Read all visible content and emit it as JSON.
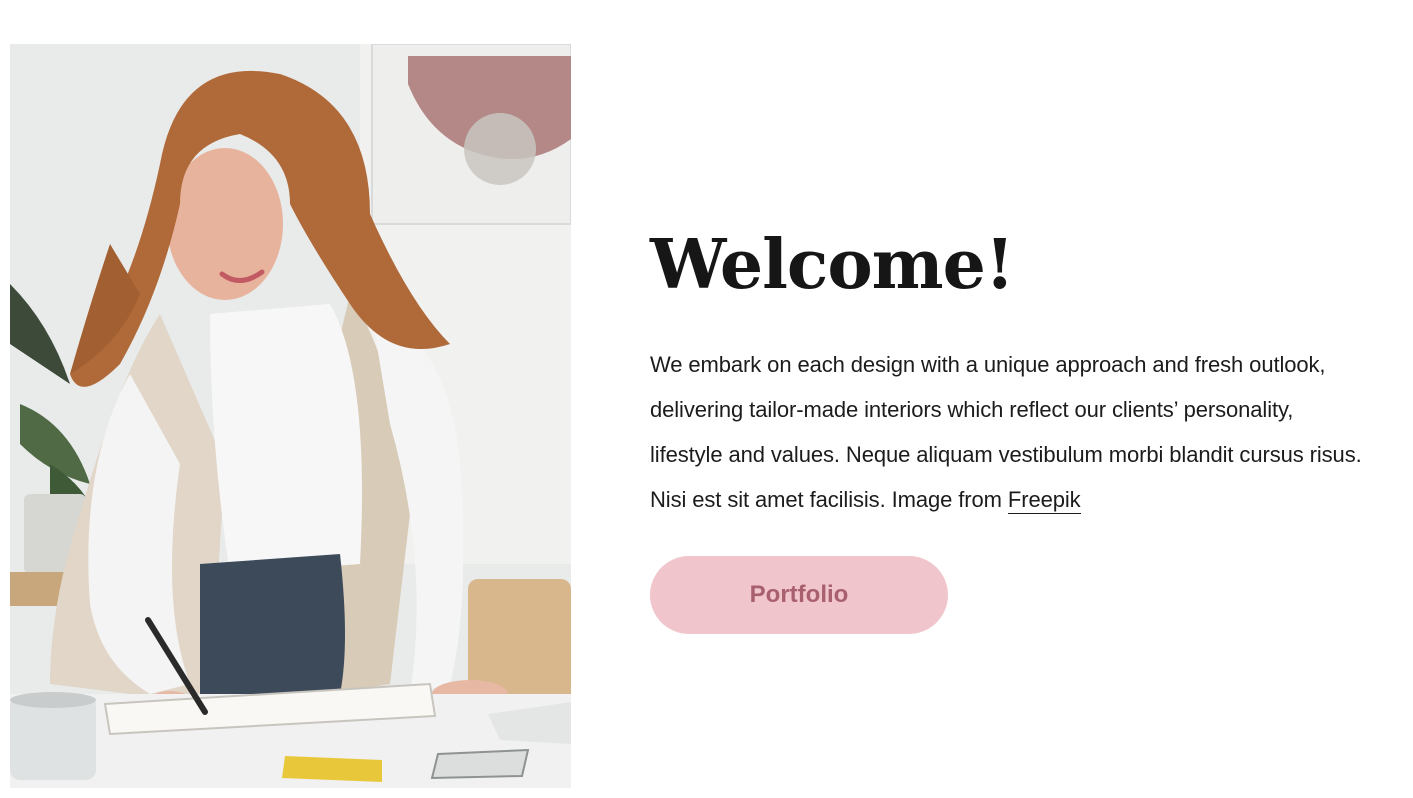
{
  "hero": {
    "image_description": "woman-at-desk-photo"
  },
  "content": {
    "title": "Welcome!",
    "intro_text": "We embark on each design with a unique approach and fresh outlook, delivering tailor-made interiors which reflect our clients’ personality, lifestyle and values. Neque aliquam vestibulum morbi blandit cursus risus. Nisi est sit amet facilisis. Image from ",
    "link_label": "Freepik",
    "button_label": "Portfolio"
  },
  "colors": {
    "button_bg": "#f1c5cc",
    "button_text": "#a9606e",
    "title": "#161616"
  }
}
